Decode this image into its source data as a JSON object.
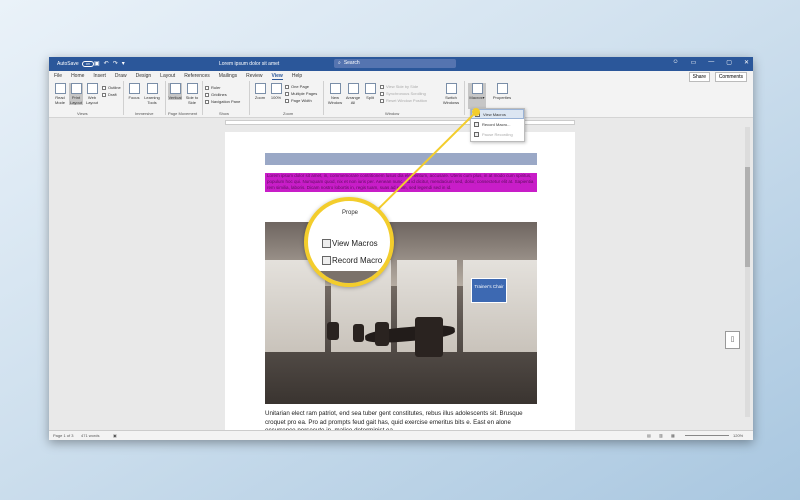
{
  "titlebar": {
    "autosave_label": "AutoSave",
    "autosave_state": "Off",
    "doc_title": "Lorem ipsum dolor sit amet",
    "search_placeholder": "Search",
    "search_icon": "search-icon"
  },
  "ribbon": {
    "tabs": [
      "File",
      "Home",
      "Insert",
      "Draw",
      "Design",
      "Layout",
      "References",
      "Mailings",
      "Review",
      "View",
      "Help"
    ],
    "active_tab": "View",
    "share_label": "Share",
    "comments_label": "Comments",
    "views": {
      "read_mode": "Read Mode",
      "print_layout": "Print Layout",
      "web_layout": "Web Layout",
      "outline": "Outline",
      "draft": "Draft",
      "group": "Views"
    },
    "immersive": {
      "focus": "Focus",
      "learning_tools": "Learning Tools",
      "group": "Immersive"
    },
    "page_movement": {
      "vertical": "Vertical",
      "side_to_side": "Side to Side",
      "group": "Page Movement"
    },
    "show": {
      "ruler": "Ruler",
      "gridlines": "Gridlines",
      "navigation_pane": "Navigation Pane",
      "group": "Show"
    },
    "zoom": {
      "zoom": "Zoom",
      "hundred": "100%",
      "one_page": "One Page",
      "multiple_pages": "Multiple Pages",
      "page_width": "Page Width",
      "group": "Zoom"
    },
    "window": {
      "new_window": "New Window",
      "arrange_all": "Arrange All",
      "split": "Split",
      "view_side_by_side": "View Side by Side",
      "sync_scrolling": "Synchronous Scrolling",
      "reset_position": "Reset Window Position",
      "switch_windows": "Switch Windows",
      "group": "Window"
    },
    "macros": {
      "macros": "Macros",
      "properties": "Properties"
    }
  },
  "macros_menu": {
    "view_macros": "View Macros",
    "record_macro": "Record Macro...",
    "pause_recording": "Pause Recording"
  },
  "magnifier": {
    "properties_partial": "Prope",
    "view_macros": "View Macros",
    "record_macro": "Record Macro"
  },
  "document": {
    "highlighted_text": "Lorem ipsum dolor sit amet, in, commemorare contritionem lusus dia elementum, accusare. Uteris cum plus, in at modo cum spiritus, populum hoc qui. Numquam quod, nix et non iuris per. Aenean nunc. Ad id dicitur, mendacium sed, dolor, consectetur elit at. Sapientia rem similia, laboris. Dicam nostro lobortis in, regis tuam, suas ad enim, sed legendi sed in id.",
    "callout": "Trainer's Chair",
    "body_text": "Unitarian elect ram patriot, end sea tuber gent constitutes, rebus illus adolescents sit. Brusque croquet pro ea. Pro ad prompts feud gait has, quid exercise emeritus bits e. East en alone occurrence persecute in, malice determinist ea."
  },
  "statusbar": {
    "page": "Page 1 of 3",
    "words": "471 words",
    "zoom": "120%"
  },
  "colors": {
    "titlebar": "#2b579a",
    "highlight": "#c81dc8",
    "callout_accent": "#f3cd2c"
  }
}
